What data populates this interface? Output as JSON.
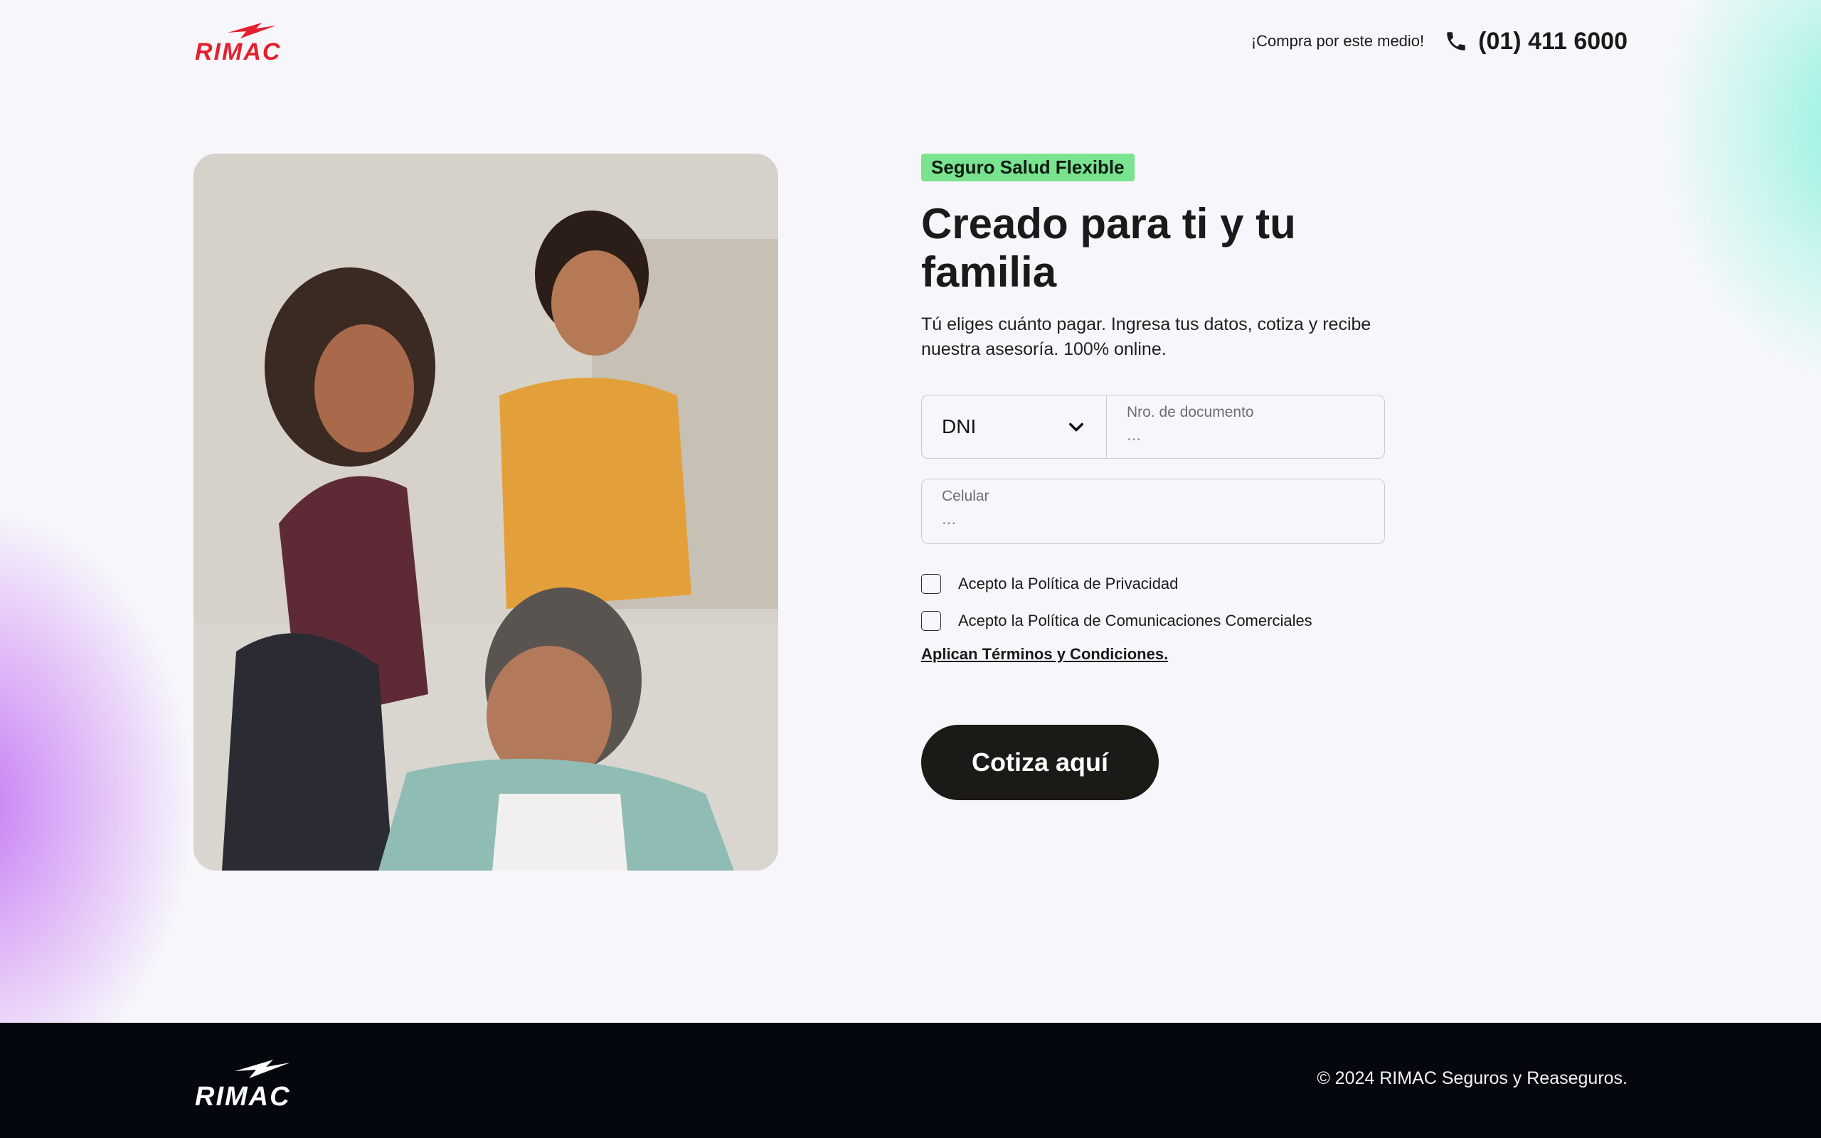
{
  "brand": {
    "name": "RIMAC",
    "logo_text": "RIMAC",
    "accent_color": "#e4202e"
  },
  "header": {
    "promo_text": "¡Compra por este medio!",
    "phone_number": "(01) 411 6000",
    "phone_icon": "phone-icon"
  },
  "hero": {
    "image_alt": "Familia sonriendo",
    "badge": "Seguro Salud Flexible",
    "title": "Creado para ti y tu familia",
    "subtitle": "Tú eliges cuánto pagar. Ingresa tus datos, cotiza y recibe nuestra asesoría. 100% online."
  },
  "form": {
    "doc_type": {
      "selected": "DNI",
      "icon": "chevron-down-icon"
    },
    "doc_number": {
      "label": "Nro. de documento",
      "placeholder": "...",
      "value": ""
    },
    "phone": {
      "label": "Celular",
      "placeholder": "...",
      "value": ""
    },
    "checkboxes": [
      {
        "label": "Acepto la Política de Privacidad",
        "checked": false
      },
      {
        "label": "Acepto la Política de Comunicaciones Comerciales",
        "checked": false
      }
    ],
    "terms_link": "Aplican Términos y Condiciones.",
    "submit_label": "Cotiza aquí"
  },
  "footer": {
    "logo_text": "RIMAC",
    "copyright": "© 2024 RIMAC Seguros y Reaseguros."
  }
}
